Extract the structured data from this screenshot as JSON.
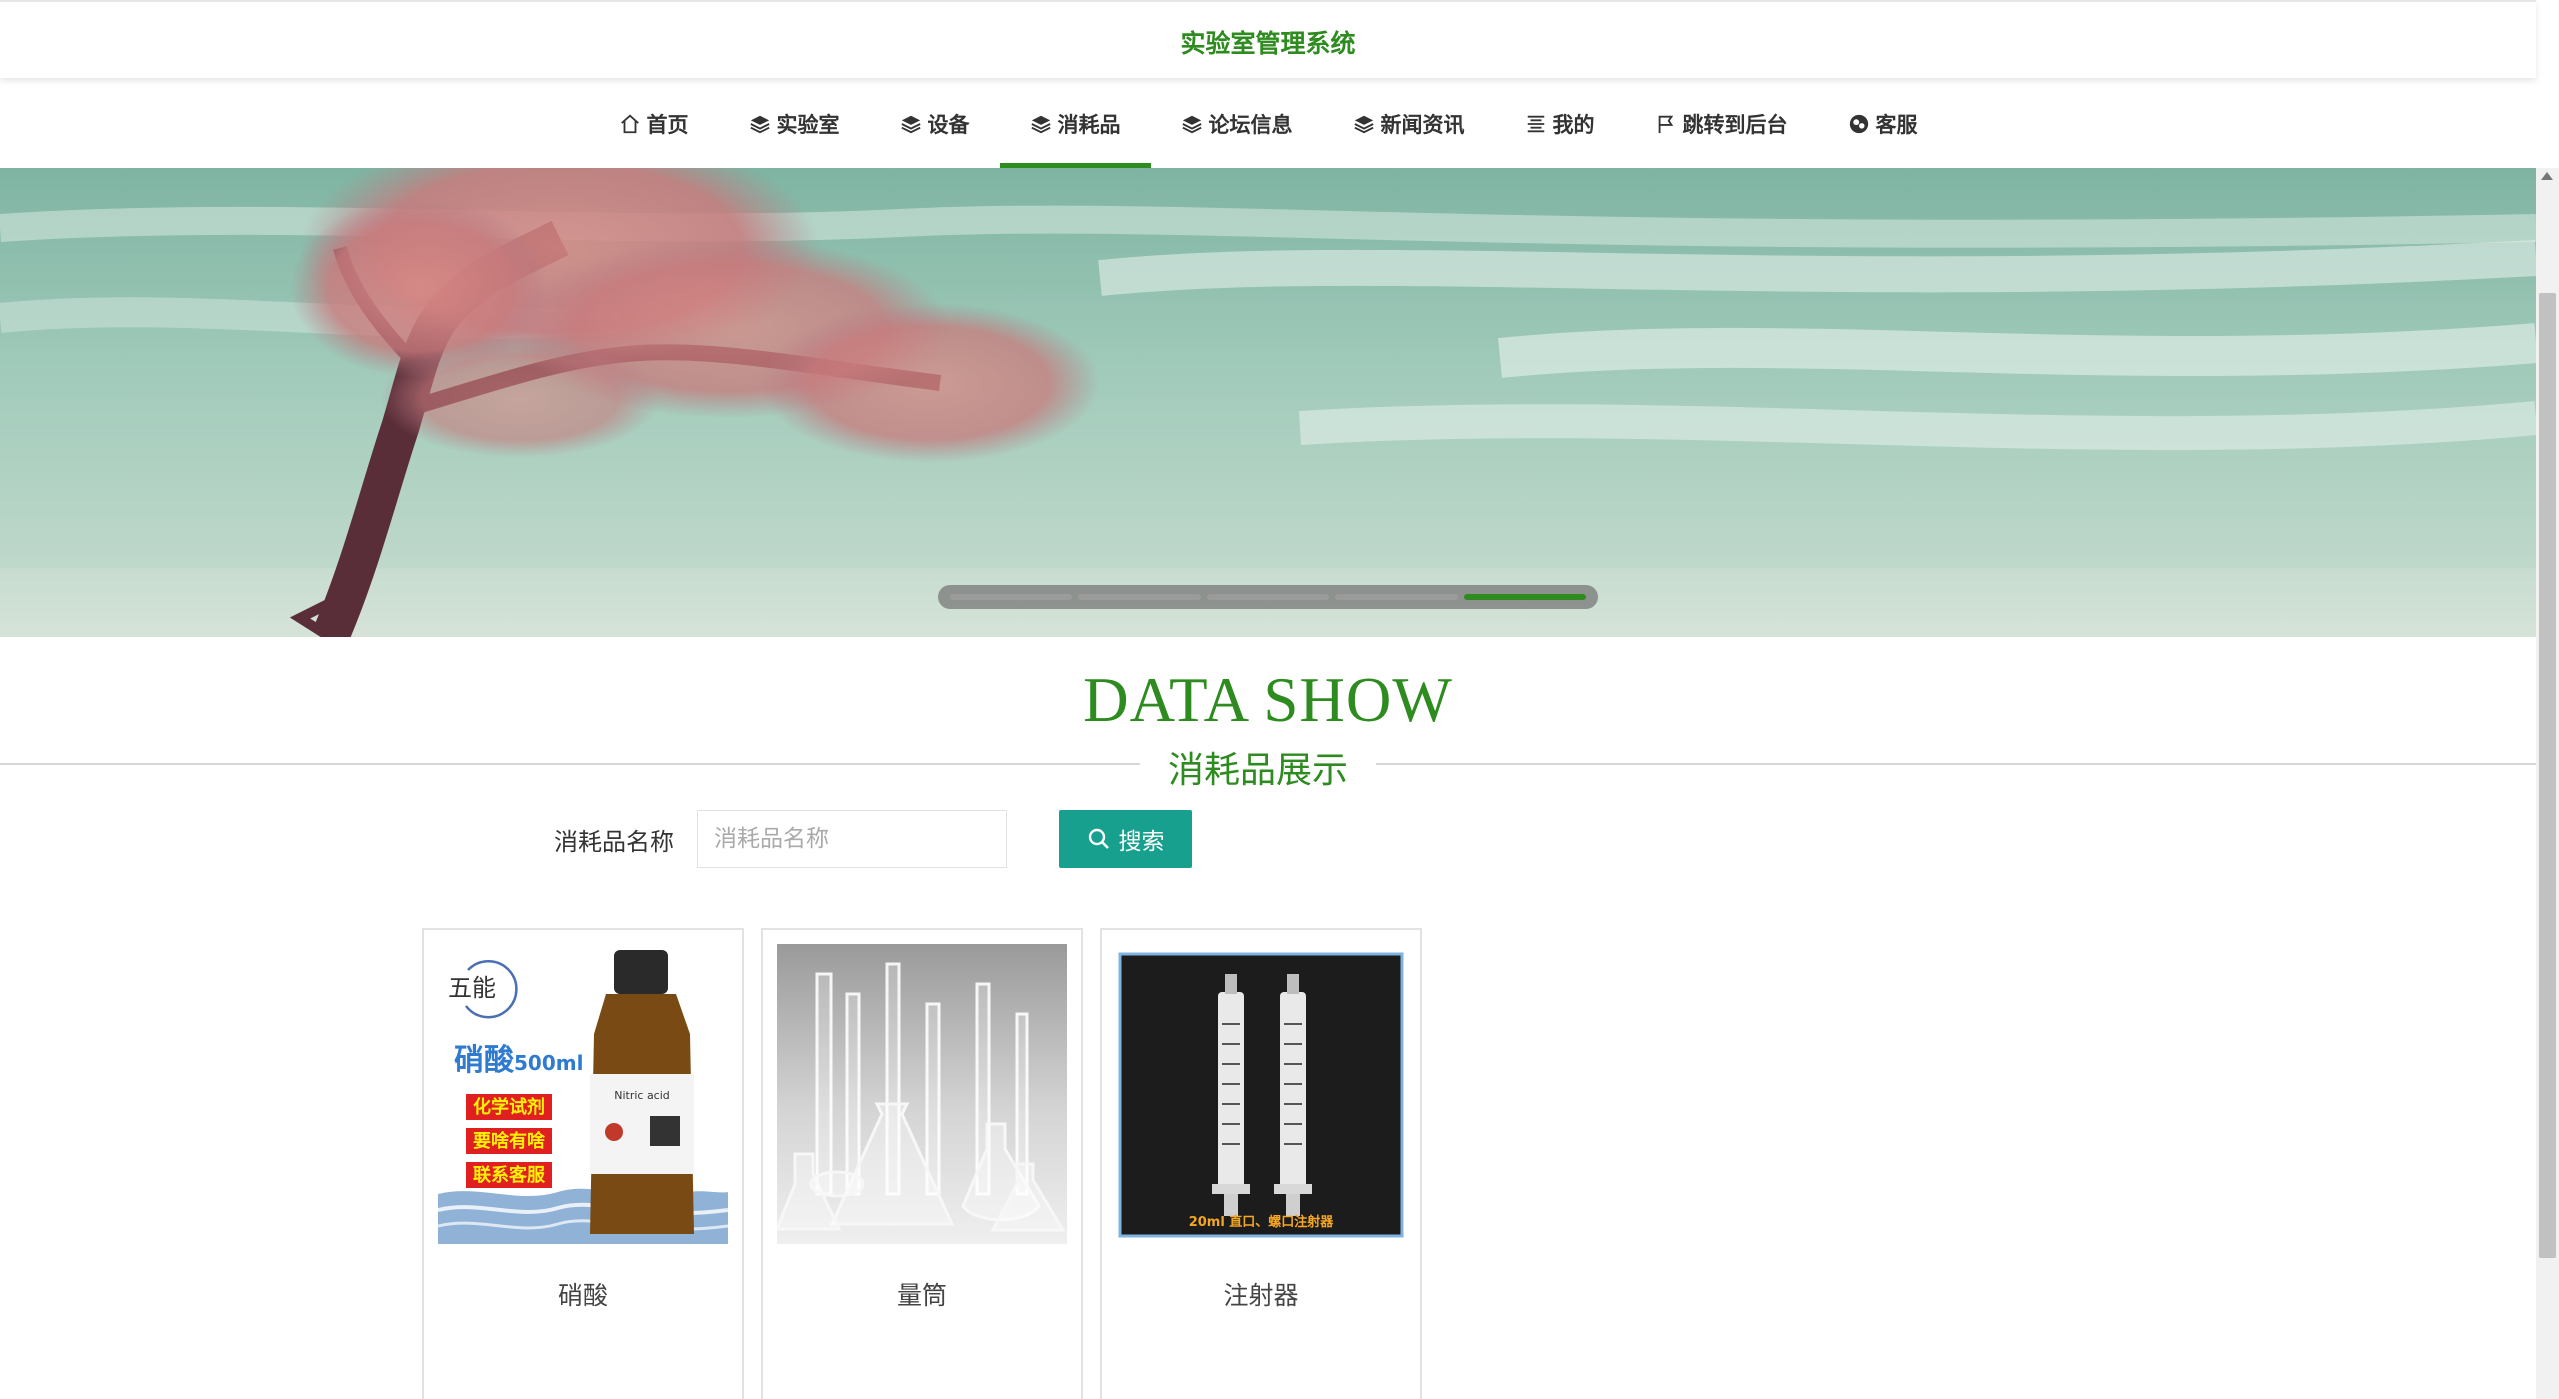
{
  "site": {
    "title": "实验室管理系统"
  },
  "nav": {
    "items": [
      {
        "label": "首页",
        "icon": "home-icon"
      },
      {
        "label": "实验室",
        "icon": "layers-icon"
      },
      {
        "label": "设备",
        "icon": "layers-icon"
      },
      {
        "label": "消耗品",
        "icon": "layers-icon",
        "active": true
      },
      {
        "label": "论坛信息",
        "icon": "layers-icon"
      },
      {
        "label": "新闻资讯",
        "icon": "layers-icon"
      },
      {
        "label": "我的",
        "icon": "list-icon"
      },
      {
        "label": "跳转到后台",
        "icon": "flag-icon"
      },
      {
        "label": "客服",
        "icon": "chat-icon"
      }
    ]
  },
  "carousel": {
    "slide_count": 5,
    "active_index": 4
  },
  "section": {
    "title": "DATA SHOW",
    "subtitle": "消耗品展示"
  },
  "search": {
    "label": "消耗品名称",
    "placeholder": "消耗品名称",
    "value": "",
    "button_label": "搜索"
  },
  "products": [
    {
      "name": "硝酸",
      "image_text": {
        "brand": "五能",
        "title": "硝酸",
        "volume": "500ml",
        "tags": [
          "化学试剂",
          "要啥有啥",
          "联系客服"
        ],
        "bottle_label": "Nitric acid"
      }
    },
    {
      "name": "量筒"
    },
    {
      "name": "注射器",
      "image_text": {
        "caption": "20ml 直口、螺口注射器"
      }
    }
  ],
  "colors": {
    "accent": "#2e8b1f",
    "button": "#17a08e",
    "text": "#333333"
  }
}
